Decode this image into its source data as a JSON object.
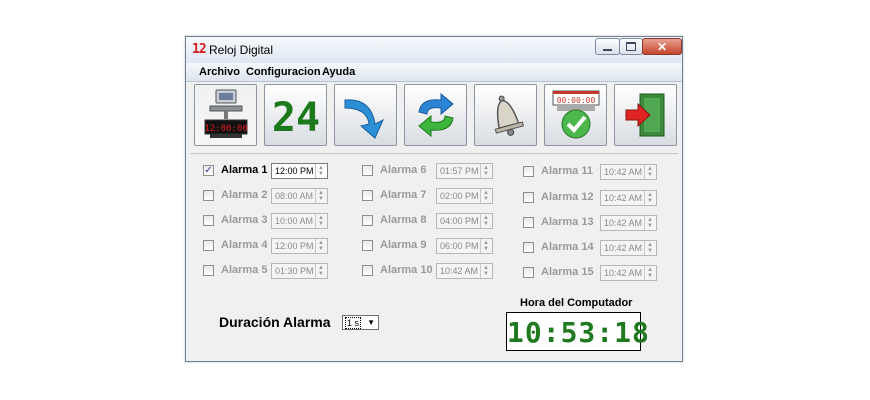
{
  "window": {
    "app_icon_text": "12",
    "title": "Reloj Digital",
    "close_glyph": "✕"
  },
  "menu": [
    "Archivo",
    "Configuracion",
    "Ayuda"
  ],
  "toolbar": {
    "buttons": [
      {
        "icon": "computer-clock-icon",
        "display": "12:00:00"
      },
      {
        "icon": "24-hour-icon",
        "display": "24"
      },
      {
        "icon": "arrow-down-right-icon"
      },
      {
        "icon": "refresh-arrows-icon"
      },
      {
        "icon": "bell-icon"
      },
      {
        "icon": "alarm-set-check-icon",
        "display": "00:00:00"
      },
      {
        "icon": "exit-door-icon"
      }
    ]
  },
  "alarms": [
    {
      "label": "Alarma 1",
      "time": "12:00 PM",
      "checked": true
    },
    {
      "label": "Alarma 2",
      "time": "08:00 AM",
      "checked": false
    },
    {
      "label": "Alarma 3",
      "time": "10:00 AM",
      "checked": false
    },
    {
      "label": "Alarma 4",
      "time": "12:00 PM",
      "checked": false
    },
    {
      "label": "Alarma 5",
      "time": "01:30 PM",
      "checked": false
    },
    {
      "label": "Alarma 6",
      "time": "01:57 PM",
      "checked": false
    },
    {
      "label": "Alarma 7",
      "time": "02:00 PM",
      "checked": false
    },
    {
      "label": "Alarma 8",
      "time": "04:00 PM",
      "checked": false
    },
    {
      "label": "Alarma 9",
      "time": "06:00 PM",
      "checked": false
    },
    {
      "label": "Alarma 10",
      "time": "10:42 AM",
      "checked": false
    },
    {
      "label": "Alarma 11",
      "time": "10:42 AM",
      "checked": false
    },
    {
      "label": "Alarma 12",
      "time": "10:42 AM",
      "checked": false
    },
    {
      "label": "Alarma 13",
      "time": "10:42 AM",
      "checked": false
    },
    {
      "label": "Alarma 14",
      "time": "10:42 AM",
      "checked": false
    },
    {
      "label": "Alarma 15",
      "time": "10:42 AM",
      "checked": false
    }
  ],
  "duration": {
    "label": "Duración Alarma",
    "value": "1 s"
  },
  "computer_time": {
    "label": "Hora del Computador",
    "value": "10:53:18"
  }
}
